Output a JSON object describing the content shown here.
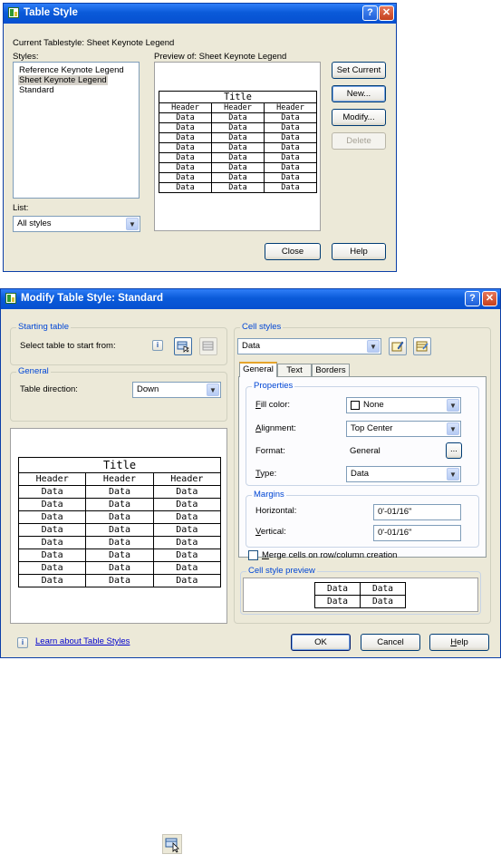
{
  "dialog1": {
    "title": "Table Style",
    "help_glyph": "?",
    "close_glyph": "✕",
    "current_style": "Current Tablestyle: Sheet Keynote Legend",
    "styles_label": "Styles:",
    "styles": [
      "Reference Keynote Legend",
      "Sheet Keynote Legend",
      "Standard"
    ],
    "selected_style_index": 1,
    "preview_label": "Preview of: Sheet Keynote Legend",
    "list_label": "List:",
    "list_value": "All styles",
    "buttons": {
      "set_current": "Set Current",
      "new": "New...",
      "modify": "Modify...",
      "delete": "Delete",
      "close": "Close",
      "help": "Help"
    },
    "preview": {
      "title": "Title",
      "headers": [
        "Header",
        "Header",
        "Header"
      ],
      "cell": "Data",
      "rows": 8
    }
  },
  "dialog2": {
    "title": "Modify Table Style: Standard",
    "help_glyph": "?",
    "close_glyph": "✕",
    "starting_table": {
      "legend": "Starting table",
      "label": "Select table to start from:",
      "info_glyph": "i"
    },
    "general": {
      "legend": "General",
      "direction_label": "Table direction:",
      "direction_value": "Down"
    },
    "preview": {
      "title": "Title",
      "headers": [
        "Header",
        "Header",
        "Header"
      ],
      "cell": "Data",
      "rows": 8
    },
    "cell_styles": {
      "legend": "Cell styles",
      "value": "Data",
      "tabs": [
        "General",
        "Text",
        "Borders"
      ],
      "active_tab": 0,
      "properties_legend": "Properties",
      "fill_color_label": "Fill color:",
      "fill_color_value": "None",
      "alignment_label": "Alignment:",
      "alignment_value": "Top Center",
      "format_label": "Format:",
      "format_value": "General",
      "format_button": "...",
      "type_label": "Type:",
      "type_value": "Data",
      "margins_legend": "Margins",
      "horizontal_label": "Horizontal:",
      "horizontal_value": "0'-01/16\"",
      "vertical_label": "Vertical:",
      "vertical_value": "0'-01/16\"",
      "merge_label": "Merge cells on row/column creation",
      "merge_checked": false,
      "cell_preview_legend": "Cell style preview",
      "cell_preview": [
        [
          "Data",
          "Data"
        ],
        [
          "Data",
          "Data"
        ]
      ]
    },
    "learn_link": "Learn about Table Styles",
    "buttons": {
      "ok": "OK",
      "cancel": "Cancel",
      "help": "Help"
    }
  },
  "standalone_icon": "select-table-icon",
  "colors": {
    "titlebar": "#0a5ad9",
    "dialog_bg": "#ece9d8",
    "group_title": "#0046d5",
    "link": "#0000cc"
  }
}
